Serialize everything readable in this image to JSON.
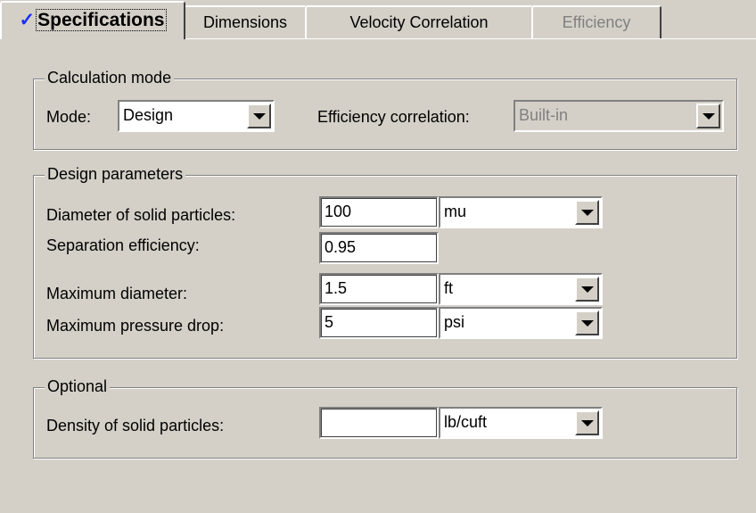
{
  "tabs": [
    {
      "label": "Specifications",
      "check": "✓",
      "state": "active"
    },
    {
      "label": "Dimensions",
      "state": "normal"
    },
    {
      "label": "Velocity Correlation",
      "state": "normal"
    },
    {
      "label": "Efficiency",
      "state": "disabled"
    }
  ],
  "calculation_mode": {
    "title": "Calculation mode",
    "mode_label": "Mode:",
    "mode_value": "Design",
    "efficiency_label": "Efficiency correlation:",
    "efficiency_value": "Built-in"
  },
  "design_parameters": {
    "title": "Design parameters",
    "rows": [
      {
        "label": "Diameter of solid particles:",
        "value": "100",
        "unit": "mu"
      },
      {
        "label": "Separation efficiency:",
        "value": "0.95"
      },
      {
        "label": "Maximum diameter:",
        "value": "1.5",
        "unit": "ft"
      },
      {
        "label": "Maximum pressure drop:",
        "value": "5",
        "unit": "psi"
      }
    ]
  },
  "optional": {
    "title": "Optional",
    "rows": [
      {
        "label": "Density of solid particles:",
        "value": "",
        "unit": "lb/cuft"
      }
    ]
  }
}
